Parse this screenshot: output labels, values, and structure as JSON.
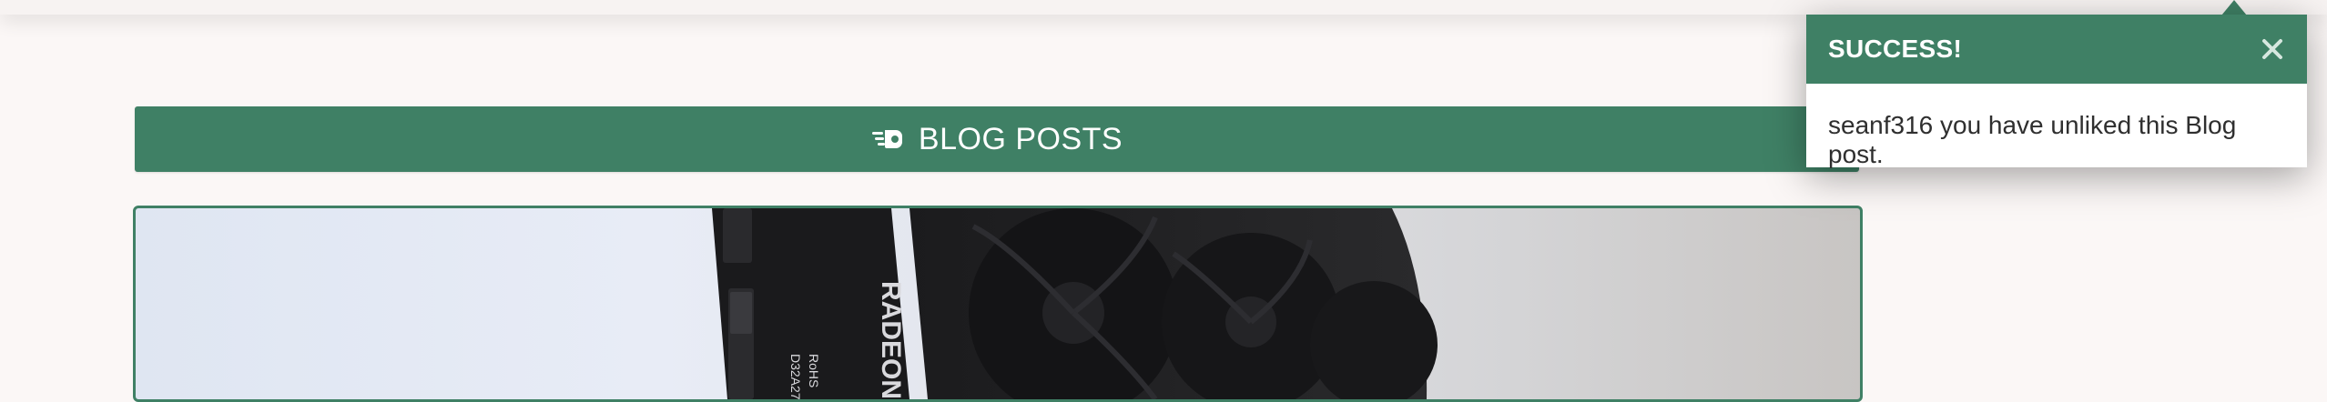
{
  "header": {
    "bar": ""
  },
  "banner": {
    "title": "BLOG POSTS",
    "icon": "hand-point-right-icon"
  },
  "toast": {
    "title": "SUCCESS!",
    "message": "seanf316 you have unliked this Blog post.",
    "close_icon": "close-icon"
  },
  "post": {
    "image_alt": "graphics card photo",
    "image_text": "RADEON"
  },
  "colors": {
    "accent": "#3f8065",
    "background": "#fbf7f6"
  }
}
